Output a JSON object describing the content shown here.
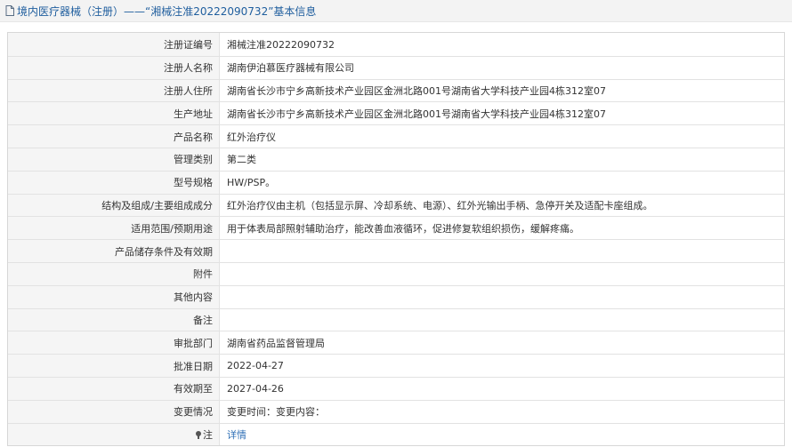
{
  "header": {
    "title": "境内医疗器械（注册）——“湘械注准20222090732”基本信息"
  },
  "rows": [
    {
      "label": "注册证编号",
      "value": "湘械注准20222090732"
    },
    {
      "label": "注册人名称",
      "value": "湖南伊泊慕医疗器械有限公司"
    },
    {
      "label": "注册人住所",
      "value": "湖南省长沙市宁乡高新技术产业园区金洲北路001号湖南省大学科技产业园4栋312室07"
    },
    {
      "label": "生产地址",
      "value": "湖南省长沙市宁乡高新技术产业园区金洲北路001号湖南省大学科技产业园4栋312室07"
    },
    {
      "label": "产品名称",
      "value": "红外治疗仪"
    },
    {
      "label": "管理类别",
      "value": "第二类"
    },
    {
      "label": "型号规格",
      "value": "HW/PSP。"
    },
    {
      "label": "结构及组成/主要组成成分",
      "value": "红外治疗仪由主机（包括显示屏、冷却系统、电源）、红外光输出手柄、急停开关及适配卡座组成。"
    },
    {
      "label": "适用范围/预期用途",
      "value": "用于体表局部照射辅助治疗，能改善血液循环，促进修复软组织损伤，缓解疼痛。"
    },
    {
      "label": "产品储存条件及有效期",
      "value": ""
    },
    {
      "label": "附件",
      "value": ""
    },
    {
      "label": "其他内容",
      "value": ""
    },
    {
      "label": "备注",
      "value": ""
    },
    {
      "label": "审批部门",
      "value": "湖南省药品监督管理局"
    },
    {
      "label": "批准日期",
      "value": "2022-04-27"
    },
    {
      "label": "有效期至",
      "value": "2027-04-26"
    },
    {
      "label": "变更情况",
      "value": "变更时间：变更内容："
    }
  ],
  "note": {
    "label": "注",
    "link": "详情",
    "icon": "pin-icon"
  }
}
